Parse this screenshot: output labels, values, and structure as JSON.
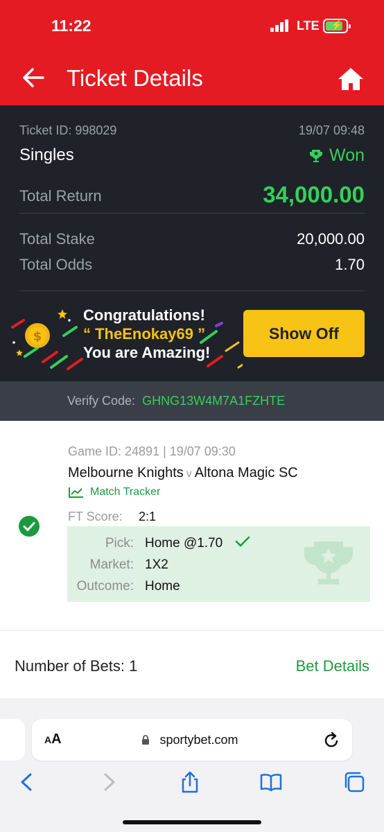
{
  "status_bar": {
    "time": "11:22",
    "network": "LTE"
  },
  "nav": {
    "title": "Ticket Details"
  },
  "ticket": {
    "id_label": "Ticket ID: 998029",
    "date": "19/07 09:48",
    "bet_type": "Singles",
    "status": "Won",
    "total_return_label": "Total Return",
    "total_return": "34,000.00",
    "total_stake_label": "Total Stake",
    "total_stake": "20,000.00",
    "total_odds_label": "Total Odds",
    "total_odds": "1.70"
  },
  "congrats": {
    "line1": "Congratulations!",
    "line2": "“ TheEnokay69 ”",
    "line3": "You are Amazing!",
    "button": "Show Off"
  },
  "verify": {
    "label": "Verify Code:",
    "code": "GHNG13W4M7A1FZHTE"
  },
  "bet": {
    "game_line": "Game ID: 24891 | 19/07 09:30",
    "home_team": "Melbourne Knights",
    "vs": "v",
    "away_team": "Altona Magic SC",
    "tracker": "Match Tracker",
    "ft_label": "FT Score:",
    "ft_score": "2:1",
    "pick_label": "Pick:",
    "pick_value": "Home @1.70",
    "market_label": "Market:",
    "market_value": "1X2",
    "outcome_label": "Outcome:",
    "outcome_value": "Home"
  },
  "footer": {
    "bets_count": "Number of Bets: 1",
    "bet_details": "Bet Details"
  },
  "browser": {
    "aa_small": "A",
    "aa_big": "A",
    "url": "sportybet.com"
  },
  "colors": {
    "brand_red": "#e41b23",
    "won_green": "#35d05a",
    "dark_bg": "#1f2229",
    "accent_yellow": "#f7c315"
  }
}
